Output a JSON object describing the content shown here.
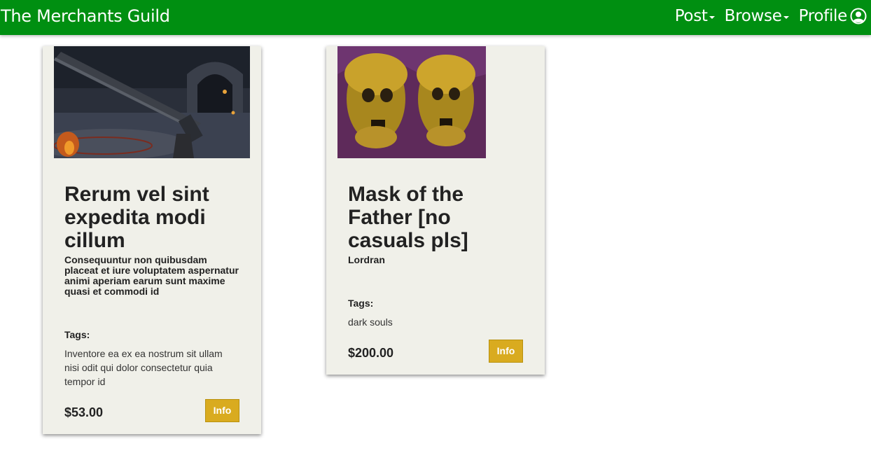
{
  "navbar": {
    "brand": "The Merchants Guild",
    "items": [
      {
        "label": "Post"
      },
      {
        "label": "Browse"
      },
      {
        "label": "Profile"
      }
    ]
  },
  "listings": [
    {
      "title": "Rerum vel sint expedita modi cillum",
      "subtitle": "Consequuntur non quibusdam placeat et iure voluptatem aspernatur animi aperiam earum sunt maxime quasi et commodi id",
      "tags_label": "Tags:",
      "tags": "Inventore ea ex ea nostrum sit ullam nisi odit qui dolor consectetur quia tempor id",
      "price": "$53.00",
      "button": "Info"
    },
    {
      "title": "Mask of the Father [no casuals pls]",
      "subtitle": "Lordran",
      "tags_label": "Tags:",
      "tags": "dark souls",
      "price": "$200.00",
      "button": "Info"
    }
  ],
  "colors": {
    "navbar": "#008f11",
    "card": "#f0f0e9",
    "button": "#d9ab1f"
  }
}
